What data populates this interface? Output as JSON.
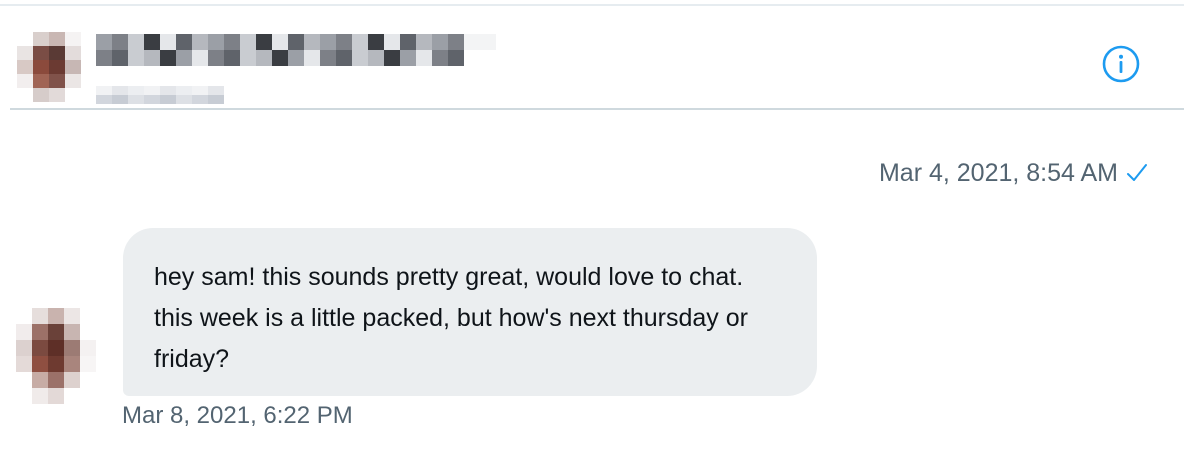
{
  "header": {
    "info_icon": "info-circle-icon",
    "avatar": "redacted-avatar",
    "name": "redacted-name"
  },
  "conversation": {
    "sent_message": {
      "timestamp": "Mar 4, 2021, 8:54 AM",
      "status_icon": "checkmark-icon"
    },
    "received_message": {
      "text": "hey sam! this sounds pretty great, would love to chat. this week is a little packed, but how's next thursday or friday?",
      "timestamp": "Mar 8, 2021, 6:22 PM"
    }
  },
  "colors": {
    "accent": "#1d9bf0",
    "meta_text": "#536471",
    "bubble": "#ebeef0",
    "divider": "#cfd9de"
  }
}
